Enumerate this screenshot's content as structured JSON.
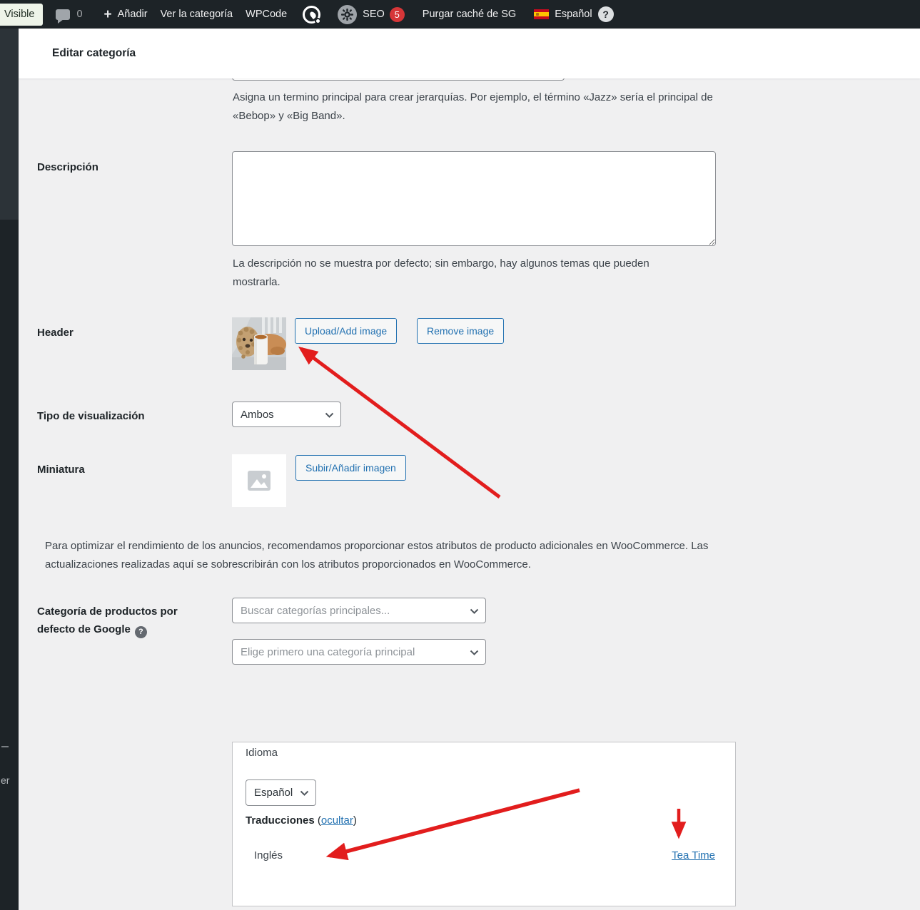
{
  "admin_bar": {
    "visible_badge": "Visible",
    "comments_count": "0",
    "add_icon": "+",
    "add_new": "Añadir",
    "view_category": "Ver la categoría",
    "wpcode": "WPCode",
    "seo_label": "SEO",
    "seo_badge_count": "5",
    "purge_cache": "Purgar caché de SG",
    "language": "Español",
    "help_icon": "?"
  },
  "sidebar": {
    "fragment": "er"
  },
  "page": {
    "title": "Editar categoría"
  },
  "form": {
    "parent_help": "Asigna un termino principal para crear jerarquías. Por ejemplo, el término «Jazz» sería el principal de «Bebop» y «Big Band».",
    "description": {
      "label": "Descripción",
      "value": "",
      "help": "La descripción no se muestra por defecto; sin embargo, hay algunos temas que pueden mostrarla."
    },
    "header_image": {
      "label": "Header",
      "upload_button": "Upload/Add image",
      "remove_button": "Remove image"
    },
    "display_type": {
      "label": "Tipo de visualización",
      "value": "Ambos"
    },
    "thumbnail": {
      "label": "Miniatura",
      "upload_button": "Subir/Añadir imagen"
    },
    "woocommerce_note": "Para optimizar el rendimiento de los anuncios, recomendamos proporcionar estos atributos de producto adicionales en WooCommerce. Las actualizaciones realizadas aquí se sobrescribirán con los atributos proporcionados en WooCommerce.",
    "google_category": {
      "label": "Categoría de productos por defecto de Google",
      "help_icon": "?",
      "select1_placeholder": "Buscar categorías principales...",
      "select2_placeholder": "Elige primero una categoría principal"
    }
  },
  "language_box": {
    "title": "Idioma",
    "selected_language": "Español",
    "translations_label": "Traducciones",
    "paren_open": "(",
    "hide_link": "ocultar",
    "paren_close": ")",
    "row_language": "Inglés",
    "row_translation_link": "Tea Time"
  },
  "colors": {
    "admin_bar_bg": "#1d2327",
    "accent_blue": "#2271b1",
    "badge_red": "#d63638",
    "arrow_red": "#e21d1d",
    "content_bg": "#f0f0f1"
  }
}
